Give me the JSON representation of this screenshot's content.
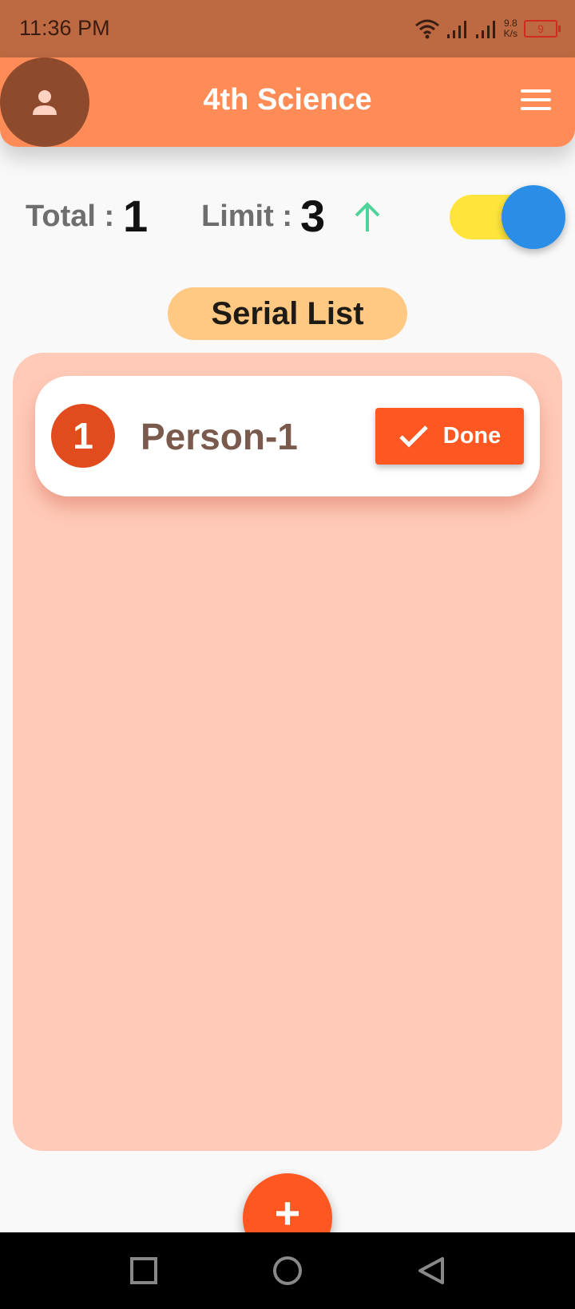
{
  "status_bar": {
    "time": "11:36 PM",
    "net_speed_value": "9.8",
    "net_speed_unit": "K/s",
    "battery": "9",
    "icons": [
      "wifi-icon",
      "signal-icon",
      "signal-icon",
      "battery-icon"
    ]
  },
  "app_bar": {
    "title": "4th Science",
    "avatar_icon": "person-icon",
    "menu_icon": "hamburger-menu-icon"
  },
  "counters": {
    "total_label": "Total :",
    "total_value": "1",
    "limit_label": "Limit :",
    "limit_value": "3",
    "limit_icon": "arrow-up-icon"
  },
  "toggle": {
    "state": "on"
  },
  "serial_list": {
    "title": "Serial List",
    "items": [
      {
        "number": "1",
        "name": "Person-1",
        "action_label": "Done",
        "action_icon": "check-icon"
      }
    ]
  },
  "fab": {
    "label": "+",
    "icon": "add-icon"
  },
  "nav_bar": {
    "buttons": [
      "recent-apps-icon",
      "home-icon",
      "back-icon"
    ]
  },
  "colors": {
    "status_bar": "#bd6a42",
    "app_bar": "#ff8c57",
    "avatar": "#8e4a2c",
    "list_panel": "#ffcab8",
    "serial_pill": "#ffc983",
    "accent": "#ff5722",
    "badge": "#e24b1d",
    "toggle_track": "#ffe53b",
    "toggle_knob": "#2a8ee6",
    "arrow": "#4fd39a"
  }
}
